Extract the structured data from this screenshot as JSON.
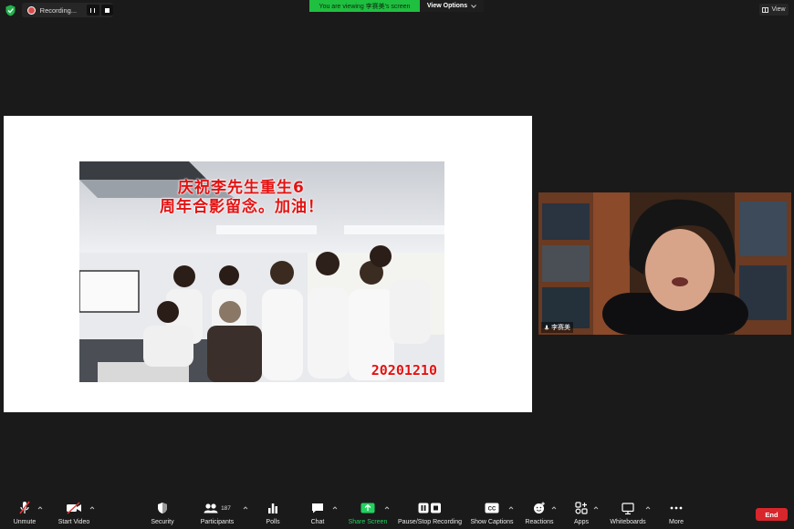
{
  "topbar": {
    "recording_label": "Recording...",
    "viewing_banner": "You are viewing 李赛美's screen",
    "view_options_label": "View Options",
    "view_label": "View"
  },
  "shared_slide": {
    "caption_line1": "庆祝李先生重生6",
    "caption_line2": "周年合影留念。加油！",
    "date_stamp": "20201210"
  },
  "participant_tile": {
    "name": "李赛美"
  },
  "toolbar": {
    "unmute": "Unmute",
    "start_video": "Start Video",
    "security": "Security",
    "participants": "Participants",
    "participant_count": "187",
    "polls": "Polls",
    "chat": "Chat",
    "share_screen": "Share Screen",
    "pause_stop_recording": "Pause/Stop Recording",
    "show_captions": "Show Captions",
    "reactions": "Reactions",
    "apps": "Apps",
    "whiteboards": "Whiteboards",
    "more": "More",
    "end": "End"
  },
  "colors": {
    "banner_green": "#1fbf3f",
    "share_green": "#23d160",
    "end_red": "#d7262c",
    "caption_red": "#e31212"
  }
}
